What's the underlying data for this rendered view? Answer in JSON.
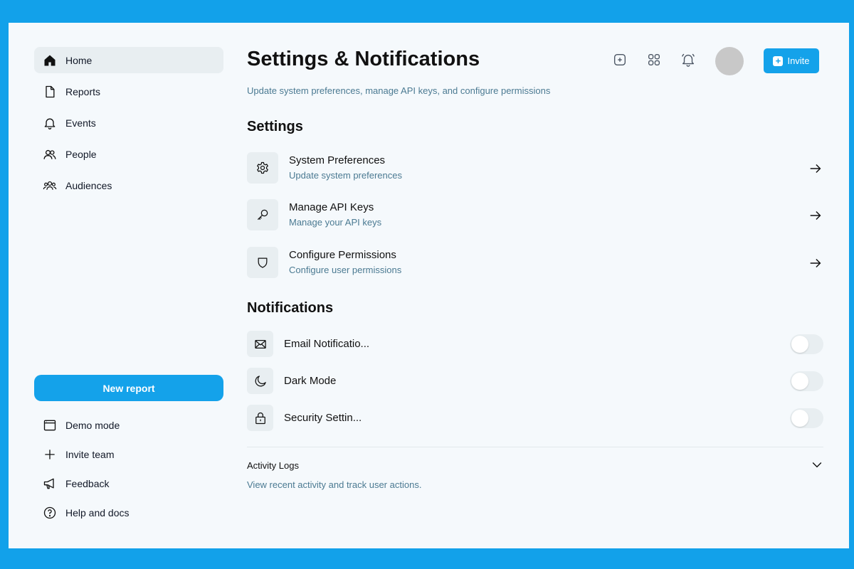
{
  "colors": {
    "frame": "#12a1ea",
    "background": "#f5f9fc",
    "accent": "#14a2ea",
    "muted_text": "#4b7a92",
    "tile": "#e8eef1"
  },
  "sidebar": {
    "items": [
      {
        "label": "Home",
        "icon": "home-icon",
        "active": true
      },
      {
        "label": "Reports",
        "icon": "file-icon"
      },
      {
        "label": "Events",
        "icon": "bell-icon"
      },
      {
        "label": "People",
        "icon": "users-icon"
      },
      {
        "label": "Audiences",
        "icon": "audience-icon"
      }
    ],
    "new_report_label": "New report",
    "bottom_items": [
      {
        "label": "Demo mode",
        "icon": "window-icon"
      },
      {
        "label": "Invite team",
        "icon": "plus-icon"
      },
      {
        "label": "Feedback",
        "icon": "megaphone-icon"
      },
      {
        "label": "Help and docs",
        "icon": "help-circle-icon"
      }
    ]
  },
  "header": {
    "title": "Settings & Notifications",
    "subtitle": "Update system preferences, manage API keys, and configure permissions",
    "icons": [
      "add-square-icon",
      "grid-icon",
      "bell-icon"
    ],
    "invite_label": "Invite"
  },
  "settings": {
    "title": "Settings",
    "items": [
      {
        "title": "System Preferences",
        "description": "Update system preferences",
        "icon": "gear-icon"
      },
      {
        "title": "Manage API Keys",
        "description": "Manage your API keys",
        "icon": "key-icon"
      },
      {
        "title": "Configure Permissions",
        "description": "Configure user permissions",
        "icon": "shield-icon"
      }
    ]
  },
  "notifications": {
    "title": "Notifications",
    "items": [
      {
        "label": "Email Notificatio...",
        "icon": "mail-icon",
        "enabled": false
      },
      {
        "label": "Dark Mode",
        "icon": "moon-icon",
        "enabled": false
      },
      {
        "label": "Security Settin...",
        "icon": "lock-icon",
        "enabled": false
      }
    ]
  },
  "activity": {
    "title": "Activity Logs",
    "description": "View recent activity and track user actions."
  }
}
